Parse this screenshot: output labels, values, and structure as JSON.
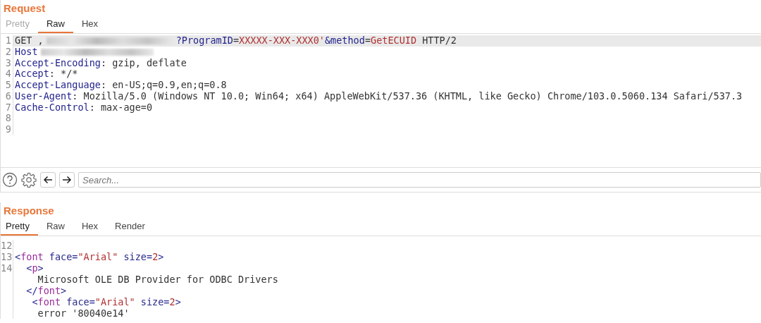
{
  "request": {
    "title": "Request",
    "tabs": [
      {
        "label": "Pretty",
        "selected": false,
        "disabled": true
      },
      {
        "label": "Raw",
        "selected": true,
        "disabled": false
      },
      {
        "label": "Hex",
        "selected": false,
        "disabled": false
      }
    ],
    "lines": [
      {
        "number": "1",
        "tokens": [
          {
            "kind": "plain",
            "text": "GET ,"
          },
          {
            "kind": "redacted"
          },
          {
            "kind": "key",
            "text": "?ProgramID"
          },
          {
            "kind": "plain",
            "text": "="
          },
          {
            "kind": "value",
            "text": "XXXXX-XXX-XXX0'"
          },
          {
            "kind": "key",
            "text": "&method"
          },
          {
            "kind": "plain",
            "text": "="
          },
          {
            "kind": "value",
            "text": "GetECUID"
          },
          {
            "kind": "plain",
            "text": " HTTP/2"
          }
        ],
        "selected": true
      },
      {
        "number": "2",
        "tokens": [
          {
            "kind": "key",
            "text": "Host"
          },
          {
            "kind": "redacted"
          }
        ],
        "selected": false
      },
      {
        "number": "3",
        "tokens": [
          {
            "kind": "key",
            "text": "Accept-Encoding"
          },
          {
            "kind": "plain",
            "text": ": gzip, deflate"
          }
        ],
        "selected": false
      },
      {
        "number": "4",
        "tokens": [
          {
            "kind": "key",
            "text": "Accept"
          },
          {
            "kind": "plain",
            "text": ": */*"
          }
        ],
        "selected": false
      },
      {
        "number": "5",
        "tokens": [
          {
            "kind": "key",
            "text": "Accept-Language"
          },
          {
            "kind": "plain",
            "text": ": en-US;q=0.9,en;q=0.8"
          }
        ],
        "selected": false
      },
      {
        "number": "6",
        "tokens": [
          {
            "kind": "key",
            "text": "User-Agent"
          },
          {
            "kind": "plain",
            "text": ": Mozilla/5.0 (Windows NT 10.0; Win64; x64) AppleWebKit/537.36 (KHTML, like Gecko) Chrome/103.0.5060.134 Safari/537.3"
          }
        ],
        "selected": false
      },
      {
        "number": "7",
        "tokens": [
          {
            "kind": "key",
            "text": "Cache-Control"
          },
          {
            "kind": "plain",
            "text": ": max-age=0"
          }
        ],
        "selected": false
      },
      {
        "number": "8",
        "selected": false
      },
      {
        "number": "9",
        "selected": false
      }
    ]
  },
  "search": {
    "placeholder": "Search..."
  },
  "response": {
    "title": "Response",
    "tabs": [
      {
        "label": "Pretty",
        "selected": true,
        "disabled": false
      },
      {
        "label": "Raw",
        "selected": false,
        "disabled": false
      },
      {
        "label": "Hex",
        "selected": false,
        "disabled": false
      },
      {
        "label": "Render",
        "selected": false,
        "disabled": false
      }
    ],
    "lines": [
      {
        "number": "12"
      },
      {
        "number": "13",
        "tokens": [
          {
            "kind": "bracket",
            "text": "<"
          },
          {
            "kind": "tag",
            "text": "font"
          },
          {
            "kind": "attr",
            "text": " face"
          },
          {
            "kind": "bracket",
            "text": "="
          },
          {
            "kind": "value",
            "text": "\"Arial\""
          },
          {
            "kind": "attr",
            "text": " size"
          },
          {
            "kind": "bracket",
            "text": "="
          },
          {
            "kind": "value",
            "text": "2"
          },
          {
            "kind": "bracket",
            "text": ">"
          }
        ]
      },
      {
        "number": "14",
        "tokens": [
          {
            "kind": "bracket",
            "text": "  <"
          },
          {
            "kind": "tag",
            "text": "p"
          },
          {
            "kind": "bracket",
            "text": ">"
          }
        ]
      },
      {
        "tokens": [
          {
            "kind": "plain",
            "text": "    Microsoft OLE DB Provider for ODBC Drivers"
          }
        ]
      },
      {
        "tokens": [
          {
            "kind": "bracket",
            "text": "  </"
          },
          {
            "kind": "tag",
            "text": "font"
          },
          {
            "kind": "bracket",
            "text": ">"
          }
        ]
      },
      {
        "tokens": [
          {
            "kind": "bracket",
            "text": "   <"
          },
          {
            "kind": "tag",
            "text": "font"
          },
          {
            "kind": "attr",
            "text": " face"
          },
          {
            "kind": "bracket",
            "text": "="
          },
          {
            "kind": "value",
            "text": "\"Arial\""
          },
          {
            "kind": "attr",
            "text": " size"
          },
          {
            "kind": "bracket",
            "text": "="
          },
          {
            "kind": "value",
            "text": "2"
          },
          {
            "kind": "bracket",
            "text": ">"
          }
        ]
      },
      {
        "tokens": [
          {
            "kind": "plain",
            "text": "    error '80040e14'"
          }
        ]
      }
    ]
  }
}
